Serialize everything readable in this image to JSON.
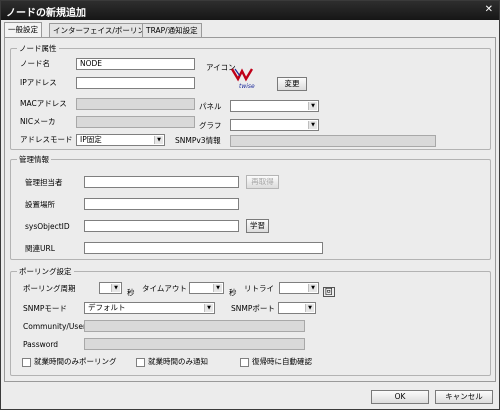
{
  "window": {
    "title": "ノードの新規追加",
    "close_glyph": "✕"
  },
  "tabs": [
    {
      "label": "一般設定"
    },
    {
      "label": "インターフェイス/ポーリング設定"
    },
    {
      "label": "TRAP/通知設定"
    }
  ],
  "node_attributes": {
    "legend": "ノード属性",
    "node_name_label": "ノード名",
    "node_name_value": "NODE",
    "ip_label": "IPアドレス",
    "ip_value": "",
    "icon_label": "アイコン",
    "icon_caption": "twise",
    "icon_name": "ntwise-logo-icon",
    "change_button": "変更",
    "mac_label": "MACアドレス",
    "mac_value": "",
    "nic_label": "NICメーカ",
    "nic_value": "",
    "panel_label": "パネル",
    "panel_value": "",
    "graph_label": "グラフ",
    "graph_value": "",
    "address_mode_label": "アドレスモード",
    "address_mode_value": "IP固定",
    "snmpv3_label": "SNMPv3情報",
    "snmpv3_value": ""
  },
  "management": {
    "legend": "管理情報",
    "admin_label": "管理担当者",
    "admin_value": "",
    "reread_button": "再取得",
    "location_label": "設置場所",
    "location_value": "",
    "sysobjectid_label": "sysObjectID",
    "sysobjectid_value": "",
    "learn_button": "学習",
    "url_label": "関連URL",
    "url_value": ""
  },
  "polling": {
    "legend": "ポーリング設定",
    "interval_label": "ポーリング周期",
    "interval_value": "",
    "interval_unit": "秒",
    "timeout_label": "タイムアウト",
    "timeout_value": "",
    "timeout_unit": "秒",
    "retry_label": "リトライ",
    "retry_value": "",
    "retry_unit": "回",
    "snmp_mode_label": "SNMPモード",
    "snmp_mode_value": "デフォルト",
    "snmp_port_label": "SNMPポート",
    "snmp_port_value": "",
    "community_label": "Community/User",
    "community_value": "",
    "password_label": "Password",
    "password_value": "",
    "checkboxes": [
      {
        "label": "就業時間のみポーリング",
        "checked": false
      },
      {
        "label": "就業時間のみ通知",
        "checked": false
      },
      {
        "label": "復帰時に自動確認",
        "checked": false
      }
    ]
  },
  "footer": {
    "ok_button": "OK",
    "cancel_button": "キャンセル"
  }
}
